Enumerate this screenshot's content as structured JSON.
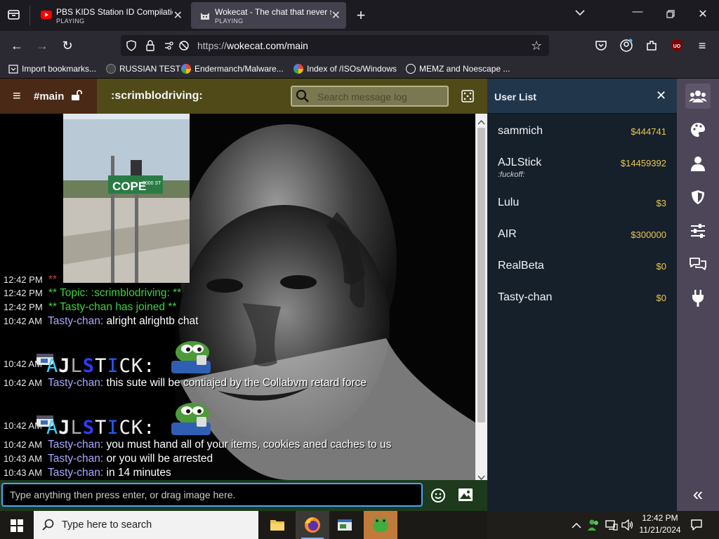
{
  "browser": {
    "tabs": [
      {
        "title": "PBS KIDS Station ID Compilation",
        "status": "PLAYING"
      },
      {
        "title": "Wokecat - The chat that never s",
        "status": "PLAYING"
      }
    ],
    "url_scheme": "https://",
    "url_host": "wokecat.com/main",
    "bookmarks": [
      "Import bookmarks...",
      "RUSSIAN TEST",
      "Endermanch/Malware...",
      "Index of /ISOs/Windows",
      "MEMZ and Noescape ..."
    ]
  },
  "chat": {
    "channel": "#main",
    "topic": ":scrimblodriving:",
    "search_placeholder": "Search message log",
    "input_placeholder": "Type anything then press enter, or drag image here.",
    "messages": [
      {
        "time": "12:42 PM",
        "kind": "system-red",
        "text": "**"
      },
      {
        "time": "12:42 PM",
        "kind": "system",
        "text": "** Topic: :scrimblodriving: **"
      },
      {
        "time": "12:42 PM",
        "kind": "system",
        "text": "** Tasty-chan has joined **"
      },
      {
        "time": "10:42 AM",
        "kind": "msg",
        "nick": "Tasty-chan:",
        "text": "alright alrightb chat"
      },
      {
        "time": "10:42 AM",
        "kind": "emote",
        "text": "AJLSTICK:"
      },
      {
        "time": "10:42 AM",
        "kind": "msg",
        "nick": "Tasty-chan:",
        "text": "this sute will be contiajed by the Collabvm retard force"
      },
      {
        "time": "10:42 AM",
        "kind": "emote",
        "text": "AJLSTICK:"
      },
      {
        "time": "10:42 AM",
        "kind": "msg",
        "nick": "Tasty-chan:",
        "text": "you must hand all of your items, cookies aned caches to us"
      },
      {
        "time": "10:43 AM",
        "kind": "msg",
        "nick": "Tasty-chan:",
        "text": "or you will be arrested"
      },
      {
        "time": "10:43 AM",
        "kind": "msg",
        "nick": "Tasty-chan:",
        "text": "in 14 minutes"
      }
    ],
    "sign_text": "COPE",
    "sign_sub": "3000 ST"
  },
  "user_list": {
    "title": "User List",
    "close": "✕",
    "users": [
      {
        "name": "sammich",
        "money": "$444741",
        "status": ""
      },
      {
        "name": "AJLStick",
        "money": "$14459392",
        "status": ":fuckoff:"
      },
      {
        "name": "Lulu",
        "money": "$3",
        "status": ""
      },
      {
        "name": "AIR",
        "money": "$300000",
        "status": ""
      },
      {
        "name": "RealBeta",
        "money": "$0",
        "status": ""
      },
      {
        "name": "Tasty-chan",
        "money": "$0",
        "status": ""
      }
    ]
  },
  "sidebar_icons": [
    "users-icon",
    "palette-icon",
    "user-icon",
    "shield-icon",
    "sliders-icon",
    "chat-bubbles-icon",
    "plug-icon"
  ],
  "taskbar": {
    "search_placeholder": "Type here to search",
    "time": "12:42 PM",
    "date": "11/21/2024"
  },
  "colors": {
    "channel_bg": "#4a2a16",
    "topic_bg": "#4f4a18",
    "userlist_bg": "#16202b",
    "sidebar_bg": "#4d4558",
    "money": "#e9c84a",
    "nick": "#a8a8ff",
    "system_green": "#3fd23f"
  }
}
